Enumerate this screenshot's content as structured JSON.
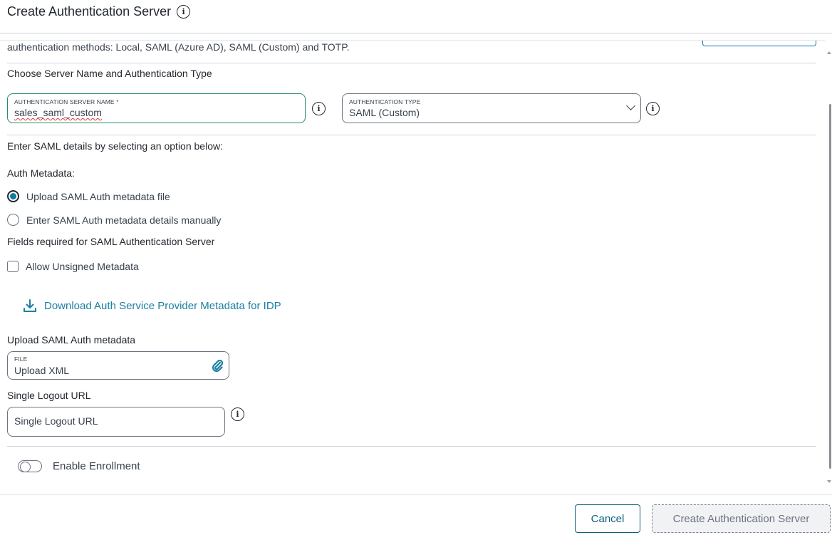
{
  "header": {
    "title": "Create Authentication Server"
  },
  "intro": {
    "description": "authentication methods: Local, SAML (Azure AD), SAML (Custom) and TOTP."
  },
  "server_section": {
    "heading": "Choose Server Name and Authentication Type",
    "name_field": {
      "label": "AUTHENTICATION SERVER NAME",
      "required_mark": "*",
      "value": "sales_saml_custom"
    },
    "type_field": {
      "label": "AUTHENTICATION TYPE",
      "selected": "SAML (Custom)"
    }
  },
  "saml_section": {
    "heading": "Enter SAML details by selecting an option below:",
    "metadata_label": "Auth Metadata:",
    "options": [
      {
        "label": "Upload SAML Auth metadata file",
        "checked": true
      },
      {
        "label": "Enter SAML Auth metadata details manually",
        "checked": false
      }
    ],
    "required_heading": "Fields required for SAML Authentication Server",
    "allow_unsigned": {
      "label": "Allow Unsigned Metadata",
      "checked": false
    },
    "download_link": "Download Auth Service Provider Metadata for IDP",
    "upload_heading": "Upload SAML Auth metadata",
    "file_field": {
      "label": "FILE",
      "placeholder": "Upload XML"
    },
    "logout_heading": "Single Logout URL",
    "logout_field": {
      "placeholder": "Single Logout URL"
    },
    "enrollment": {
      "label": "Enable Enrollment",
      "enabled": false
    }
  },
  "footer": {
    "cancel_label": "Cancel",
    "create_label": "Create Authentication Server"
  },
  "colors": {
    "accent": "#0d7aa0",
    "focus_border": "#2a8a6e",
    "link": "#1a7fa3"
  }
}
